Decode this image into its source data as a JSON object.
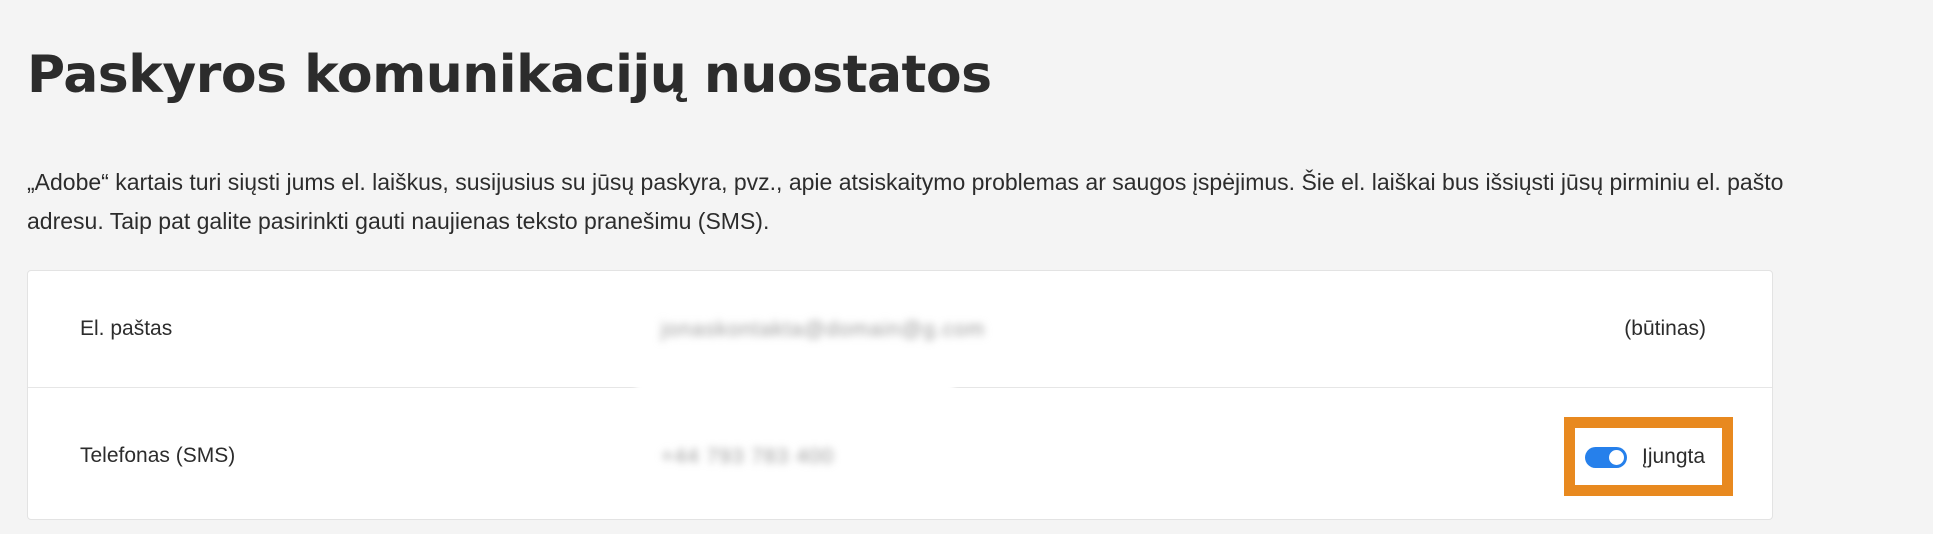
{
  "page": {
    "title": "Paskyros komunikacijų nuostatos",
    "intro": "„Adobe“ kartais turi siųsti jums el. laiškus, susijusius su jūsų paskyra, pvz., apie atsiskaitymo problemas ar saugos įspėjimus. Šie el. laiškai bus išsiųsti jūsų pirminiu el. pašto adresu. Taip pat galite pasirinkti gauti naujienas teksto pranešimu (SMS)."
  },
  "rows": {
    "email": {
      "label": "El. paštas",
      "value": "jonaskontakta@domain@g.com",
      "status": "(būtinas)"
    },
    "phone": {
      "label": "Telefonas (SMS)",
      "value": "+44 793 783 400",
      "toggle_state": "on",
      "toggle_label": "Įjungta"
    }
  },
  "colors": {
    "toggle_on": "#2680eb",
    "highlight": "#e8891f"
  }
}
